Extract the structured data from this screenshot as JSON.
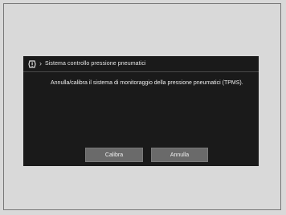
{
  "dialog": {
    "title": "Sistema controllo pressione pneumatici",
    "title_icon": "tire-pressure-warning-icon",
    "breadcrumb_icon": "chevron-right-icon",
    "message": "Annulla/calibra il sistema di monitoraggio della pressione pneumatici (TPMS).",
    "buttons": {
      "calibrate_label": "Calibra",
      "cancel_label": "Annulla"
    }
  },
  "colors": {
    "screen_background": "#1a1a1a",
    "button_background": "#6a6a6a",
    "page_background": "#d9d9d9"
  }
}
